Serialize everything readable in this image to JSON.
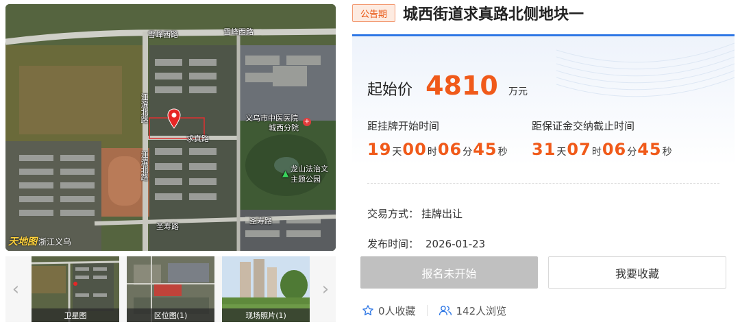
{
  "listing": {
    "status": "公告期",
    "title": "城西街道求真路北侧地块一"
  },
  "price": {
    "label": "起始价",
    "value": "4810",
    "unit": "万元"
  },
  "countdown_listing": {
    "label": "距挂牌开始时间",
    "days": "19",
    "hours": "00",
    "minutes": "06",
    "seconds": "45"
  },
  "countdown_deposit": {
    "label": "距保证金交纳截止时间",
    "days": "31",
    "hours": "07",
    "minutes": "06",
    "seconds": "45"
  },
  "units": {
    "day": "天",
    "hour": "时",
    "minute": "分",
    "second": "秒"
  },
  "details": {
    "method_label": "交易方式：",
    "method_value": "挂牌出让",
    "publish_label": "发布时间：",
    "publish_value": "2026-01-23"
  },
  "buttons": {
    "register": "报名未开始",
    "collect": "我要收藏"
  },
  "stats": {
    "favorites": "0人收藏",
    "views": "142人浏览"
  },
  "map": {
    "road_labels": [
      "雪峰西路",
      "雪峰西路",
      "求真路",
      "圣寿路",
      "圣寿路",
      "江滨北路",
      "江滨北路"
    ],
    "poi_hospital": [
      "义乌市中医医院",
      "城西分院"
    ],
    "poi_park": [
      "龙山法治文",
      "主题公园"
    ],
    "logo_brand": "天地图",
    "logo_suffix": "浙江义乌"
  },
  "thumbnails": [
    {
      "caption": "卫星图"
    },
    {
      "caption": "区位图(1)"
    },
    {
      "caption": "现场照片(1)"
    }
  ],
  "icons": {
    "prev": "chevron-left-icon",
    "next": "chevron-right-icon",
    "star": "star-icon",
    "users": "users-icon",
    "pin": "map-pin-icon"
  },
  "colors": {
    "accent_orange": "#f05a1a",
    "badge_bg": "#fdebe1",
    "badge_border": "#f39a72",
    "panel_blue": "#2e77e5",
    "disabled_button": "#c0c0c0"
  }
}
